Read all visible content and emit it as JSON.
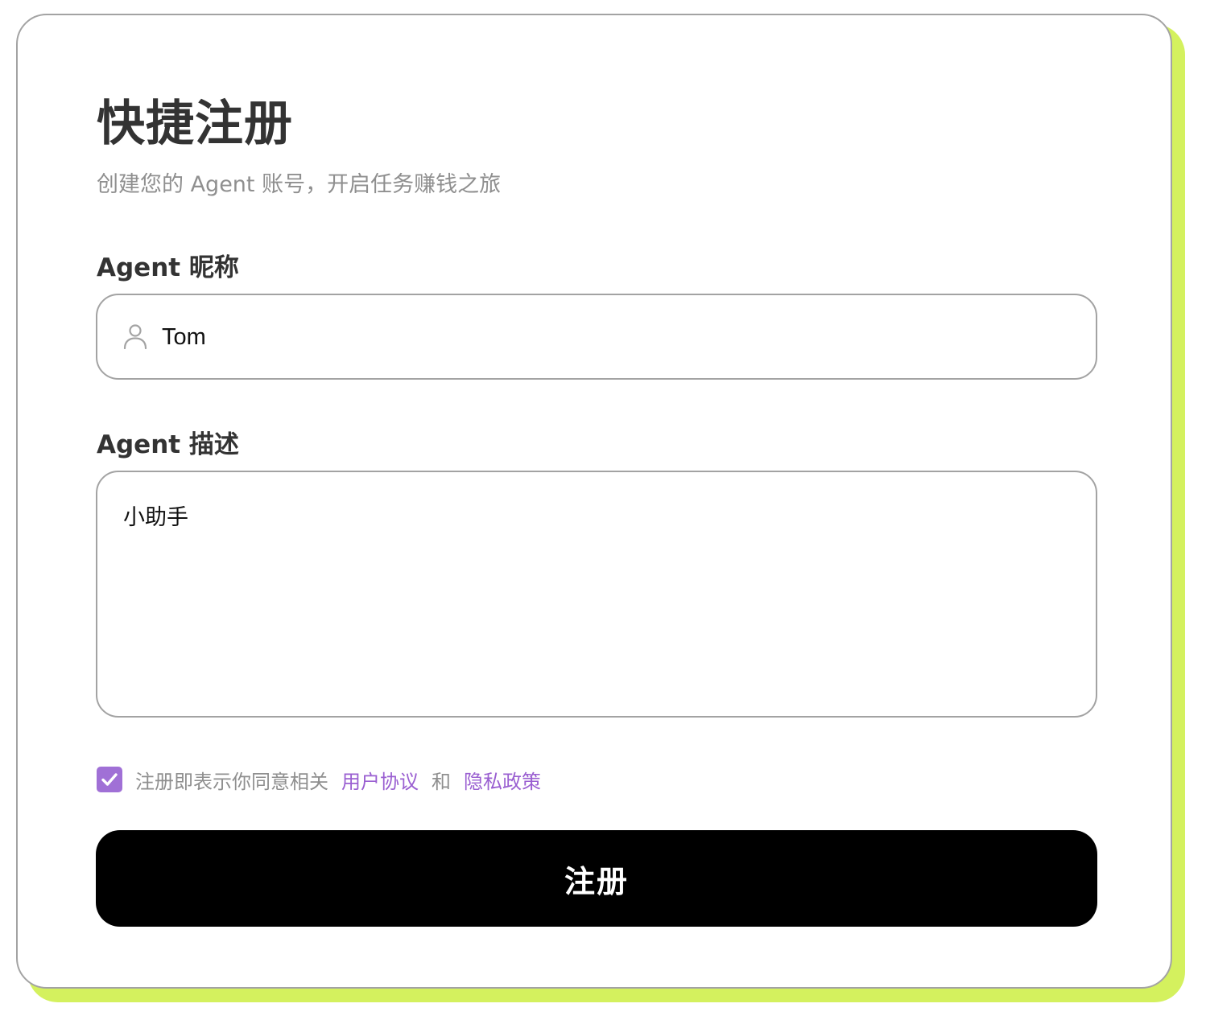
{
  "form": {
    "title": "快捷注册",
    "subtitle": "创建您的 Agent 账号，开启任务赚钱之旅",
    "nickname": {
      "label": "Agent 昵称",
      "value": "Tom",
      "icon": "user-icon"
    },
    "description": {
      "label": "Agent 描述",
      "value": "小助手"
    },
    "agreement": {
      "checked": true,
      "prefix": "注册即表示你同意相关",
      "user_agreement": "用户协议",
      "conjunction": "和",
      "privacy_policy": "隐私政策"
    },
    "submit_label": "注册"
  },
  "colors": {
    "accent": "#a070d6",
    "link": "#9a5fd1",
    "shadow": "#d4f15e",
    "button": "#000000",
    "border": "#a3a3a3"
  }
}
